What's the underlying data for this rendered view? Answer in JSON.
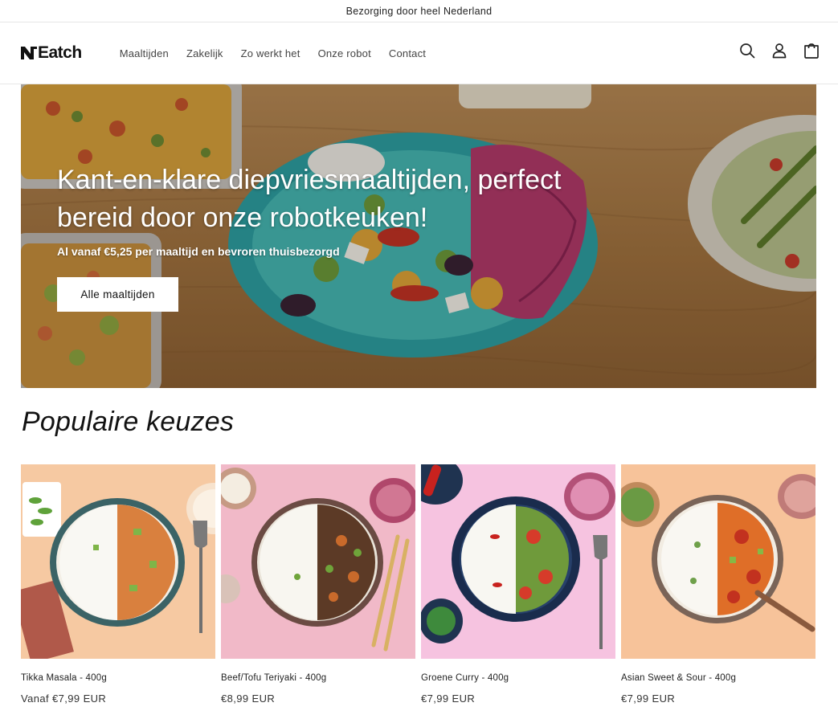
{
  "announcement": "Bezorging door heel Nederland",
  "header": {
    "logo": "Eatch",
    "nav": [
      "Maaltijden",
      "Zakelijk",
      "Zo werkt het",
      "Onze robot",
      "Contact"
    ],
    "icons": [
      "search-icon",
      "account-icon",
      "cart-icon"
    ]
  },
  "hero": {
    "title": "Kant-en-klare diepvriesmaaltijden, perfect bereid door onze robotkeuken!",
    "subtitle": "Al vanaf €5,25 per maaltijd en bevroren thuisbezorgd",
    "button": "Alle maaltijden"
  },
  "section": {
    "title": "Populaire keuzes"
  },
  "products": [
    {
      "name": "Tikka Masala - 400g",
      "price": "Vanaf €7,99 EUR",
      "bg": "#f6c9a2"
    },
    {
      "name": "Beef/Tofu Teriyaki - 400g",
      "price": "€8,99 EUR",
      "bg": "#f1b9c8"
    },
    {
      "name": "Groene Curry - 400g",
      "price": "€7,99 EUR",
      "bg": "#f6c3e0"
    },
    {
      "name": "Asian Sweet & Sour - 400g",
      "price": "€7,99 EUR",
      "bg": "#f7c39a"
    }
  ]
}
